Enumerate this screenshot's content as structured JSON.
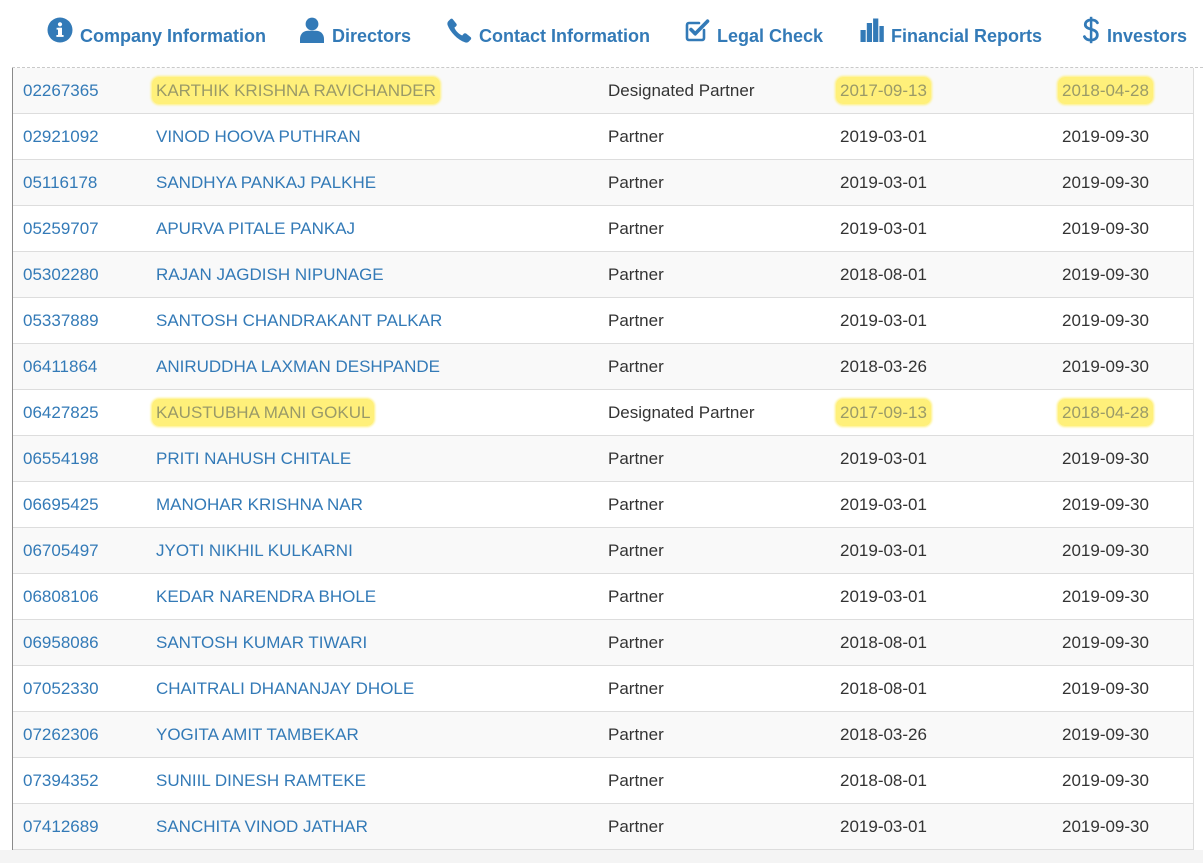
{
  "nav": {
    "items": [
      {
        "label": "Company Information",
        "icon": "info-circle-icon"
      },
      {
        "label": "Directors",
        "icon": "user-icon"
      },
      {
        "label": "Contact Information",
        "icon": "phone-icon"
      },
      {
        "label": "Legal Check",
        "icon": "checkbox-edit-icon"
      },
      {
        "label": "Financial Reports",
        "icon": "bar-chart-icon"
      },
      {
        "label": "Investors",
        "icon": "dollar-icon"
      }
    ],
    "color": "#337ab7"
  },
  "table": {
    "highlight_color": "#fff07a",
    "rows": [
      {
        "din": "02267365",
        "name": "KARTHIK KRISHNA RAVICHANDER",
        "designation": "Designated Partner",
        "appointed": "2017-09-13",
        "ceased": "2018-04-28",
        "highlighted": true
      },
      {
        "din": "02921092",
        "name": "VINOD HOOVA PUTHRAN",
        "designation": "Partner",
        "appointed": "2019-03-01",
        "ceased": "2019-09-30",
        "highlighted": false
      },
      {
        "din": "05116178",
        "name": "SANDHYA PANKAJ PALKHE",
        "designation": "Partner",
        "appointed": "2019-03-01",
        "ceased": "2019-09-30",
        "highlighted": false
      },
      {
        "din": "05259707",
        "name": "APURVA PITALE PANKAJ",
        "designation": "Partner",
        "appointed": "2019-03-01",
        "ceased": "2019-09-30",
        "highlighted": false
      },
      {
        "din": "05302280",
        "name": "RAJAN JAGDISH NIPUNAGE",
        "designation": "Partner",
        "appointed": "2018-08-01",
        "ceased": "2019-09-30",
        "highlighted": false
      },
      {
        "din": "05337889",
        "name": "SANTOSH CHANDRAKANT PALKAR",
        "designation": "Partner",
        "appointed": "2019-03-01",
        "ceased": "2019-09-30",
        "highlighted": false
      },
      {
        "din": "06411864",
        "name": "ANIRUDDHA LAXMAN DESHPANDE",
        "designation": "Partner",
        "appointed": "2018-03-26",
        "ceased": "2019-09-30",
        "highlighted": false
      },
      {
        "din": "06427825",
        "name": "KAUSTUBHA MANI GOKUL",
        "designation": "Designated Partner",
        "appointed": "2017-09-13",
        "ceased": "2018-04-28",
        "highlighted": true
      },
      {
        "din": "06554198",
        "name": "PRITI NAHUSH CHITALE",
        "designation": "Partner",
        "appointed": "2019-03-01",
        "ceased": "2019-09-30",
        "highlighted": false
      },
      {
        "din": "06695425",
        "name": "MANOHAR KRISHNA NAR",
        "designation": "Partner",
        "appointed": "2019-03-01",
        "ceased": "2019-09-30",
        "highlighted": false
      },
      {
        "din": "06705497",
        "name": "JYOTI NIKHIL KULKARNI",
        "designation": "Partner",
        "appointed": "2019-03-01",
        "ceased": "2019-09-30",
        "highlighted": false
      },
      {
        "din": "06808106",
        "name": "KEDAR NARENDRA BHOLE",
        "designation": "Partner",
        "appointed": "2019-03-01",
        "ceased": "2019-09-30",
        "highlighted": false
      },
      {
        "din": "06958086",
        "name": "SANTOSH KUMAR TIWARI",
        "designation": "Partner",
        "appointed": "2018-08-01",
        "ceased": "2019-09-30",
        "highlighted": false
      },
      {
        "din": "07052330",
        "name": "CHAITRALI DHANANJAY DHOLE",
        "designation": "Partner",
        "appointed": "2018-08-01",
        "ceased": "2019-09-30",
        "highlighted": false
      },
      {
        "din": "07262306",
        "name": "YOGITA AMIT TAMBEKAR",
        "designation": "Partner",
        "appointed": "2018-03-26",
        "ceased": "2019-09-30",
        "highlighted": false
      },
      {
        "din": "07394352",
        "name": "SUNIIL DINESH RAMTEKE",
        "designation": "Partner",
        "appointed": "2018-08-01",
        "ceased": "2019-09-30",
        "highlighted": false
      },
      {
        "din": "07412689",
        "name": "SANCHITA VINOD JATHAR",
        "designation": "Partner",
        "appointed": "2019-03-01",
        "ceased": "2019-09-30",
        "highlighted": false
      }
    ]
  }
}
